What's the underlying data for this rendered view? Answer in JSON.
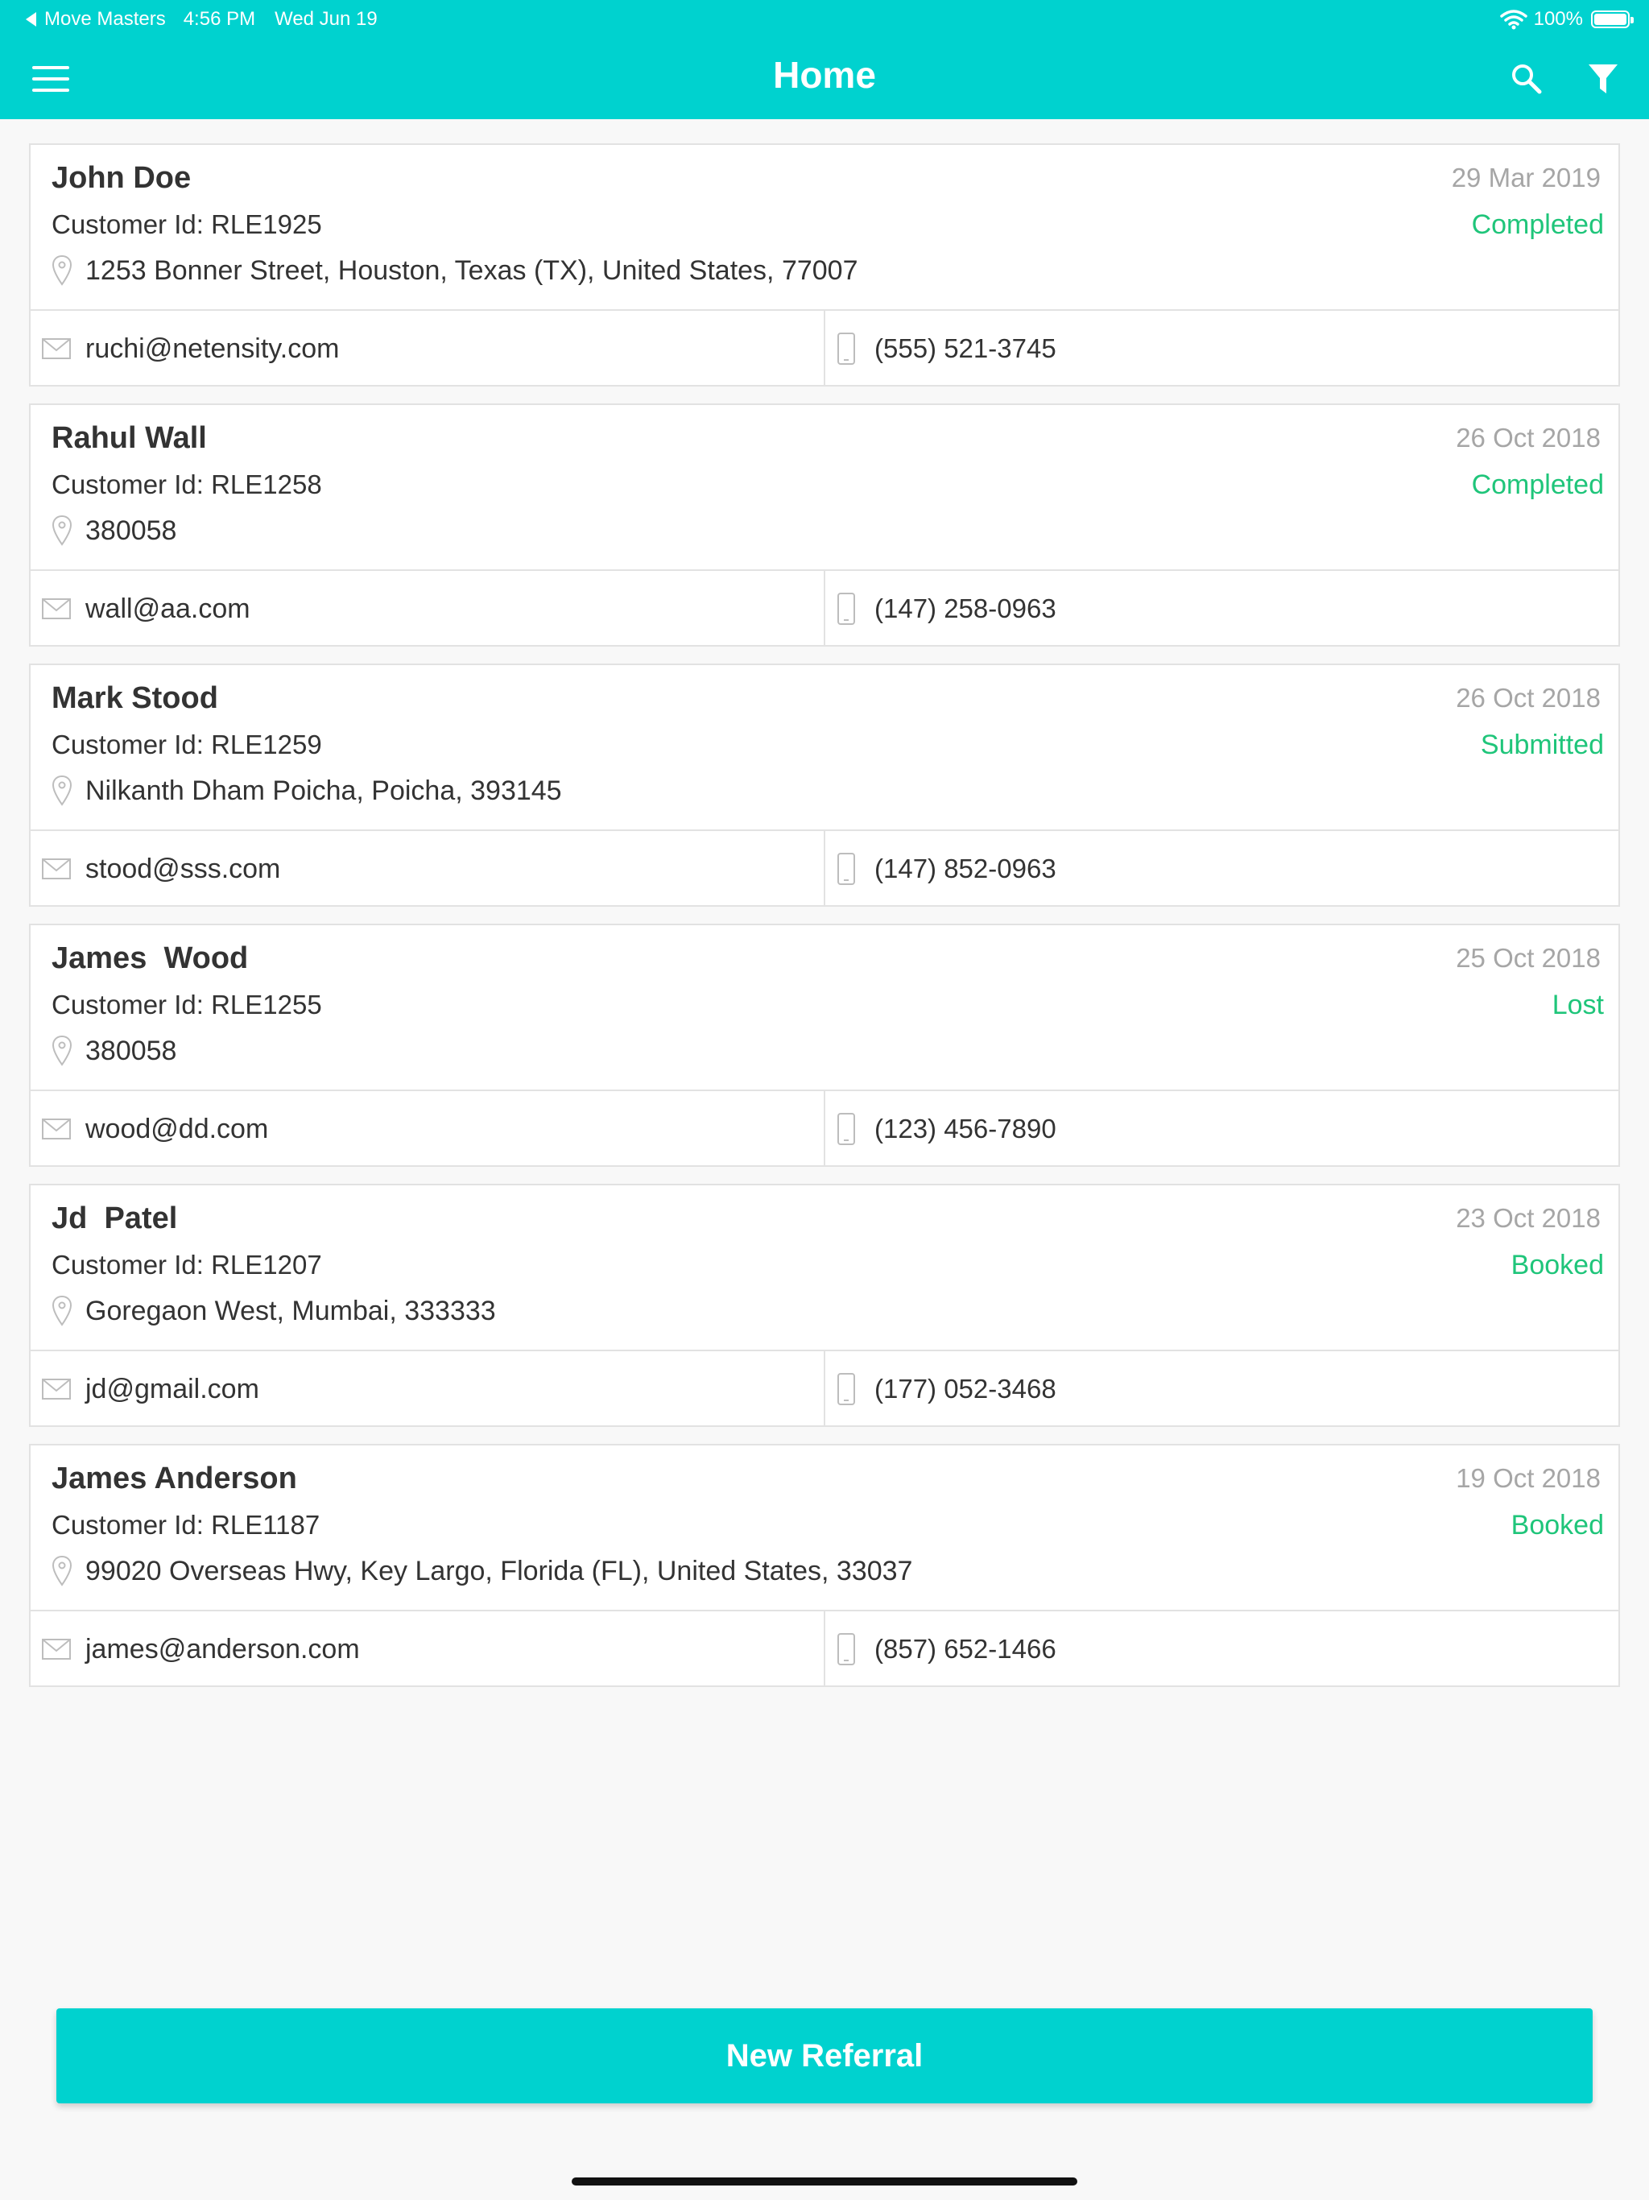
{
  "status_bar": {
    "back_app": "Move Masters",
    "time": "4:56 PM",
    "date": "Wed Jun 19",
    "battery": "100%"
  },
  "header": {
    "title": "Home",
    "menu_icon": "hamburger-menu-icon",
    "search_icon": "search-icon",
    "filter_icon": "filter-icon"
  },
  "colors": {
    "accent": "#00d2cf",
    "status": "#1fc57a",
    "date": "#a6a6a6",
    "border": "#e2e2e2"
  },
  "customers": [
    {
      "name": "John Doe",
      "date": "29 Mar 2019",
      "customer_id": "Customer Id: RLE1925",
      "status": "Completed",
      "address": "1253 Bonner Street, Houston, Texas (TX), United States, 77007",
      "email": "ruchi@netensity.com",
      "phone": "(555) 521-3745"
    },
    {
      "name": "Rahul Wall",
      "date": "26 Oct 2018",
      "customer_id": "Customer Id: RLE1258",
      "status": "Completed",
      "address": "380058",
      "email": "wall@aa.com",
      "phone": "(147) 258-0963"
    },
    {
      "name": "Mark Stood",
      "date": "26 Oct 2018",
      "customer_id": "Customer Id: RLE1259",
      "status": "Submitted",
      "address": "Nilkanth Dham Poicha, Poicha, 393145",
      "email": "stood@sss.com",
      "phone": "(147) 852-0963"
    },
    {
      "name": "James  Wood",
      "date": "25 Oct 2018",
      "customer_id": "Customer Id: RLE1255",
      "status": "Lost",
      "address": "380058",
      "email": "wood@dd.com",
      "phone": "(123) 456-7890"
    },
    {
      "name": "Jd  Patel",
      "date": "23 Oct 2018",
      "customer_id": "Customer Id: RLE1207",
      "status": "Booked",
      "address": "Goregaon West, Mumbai, 333333",
      "email": "jd@gmail.com",
      "phone": "(177) 052-3468"
    },
    {
      "name": "James Anderson",
      "date": "19 Oct 2018",
      "customer_id": "Customer Id: RLE1187",
      "status": "Booked",
      "address": "99020 Overseas Hwy, Key Largo, Florida (FL), United States, 33037",
      "email": "james@anderson.com",
      "phone": "(857) 652-1466"
    }
  ],
  "footer": {
    "new_referral_label": "New Referral"
  }
}
